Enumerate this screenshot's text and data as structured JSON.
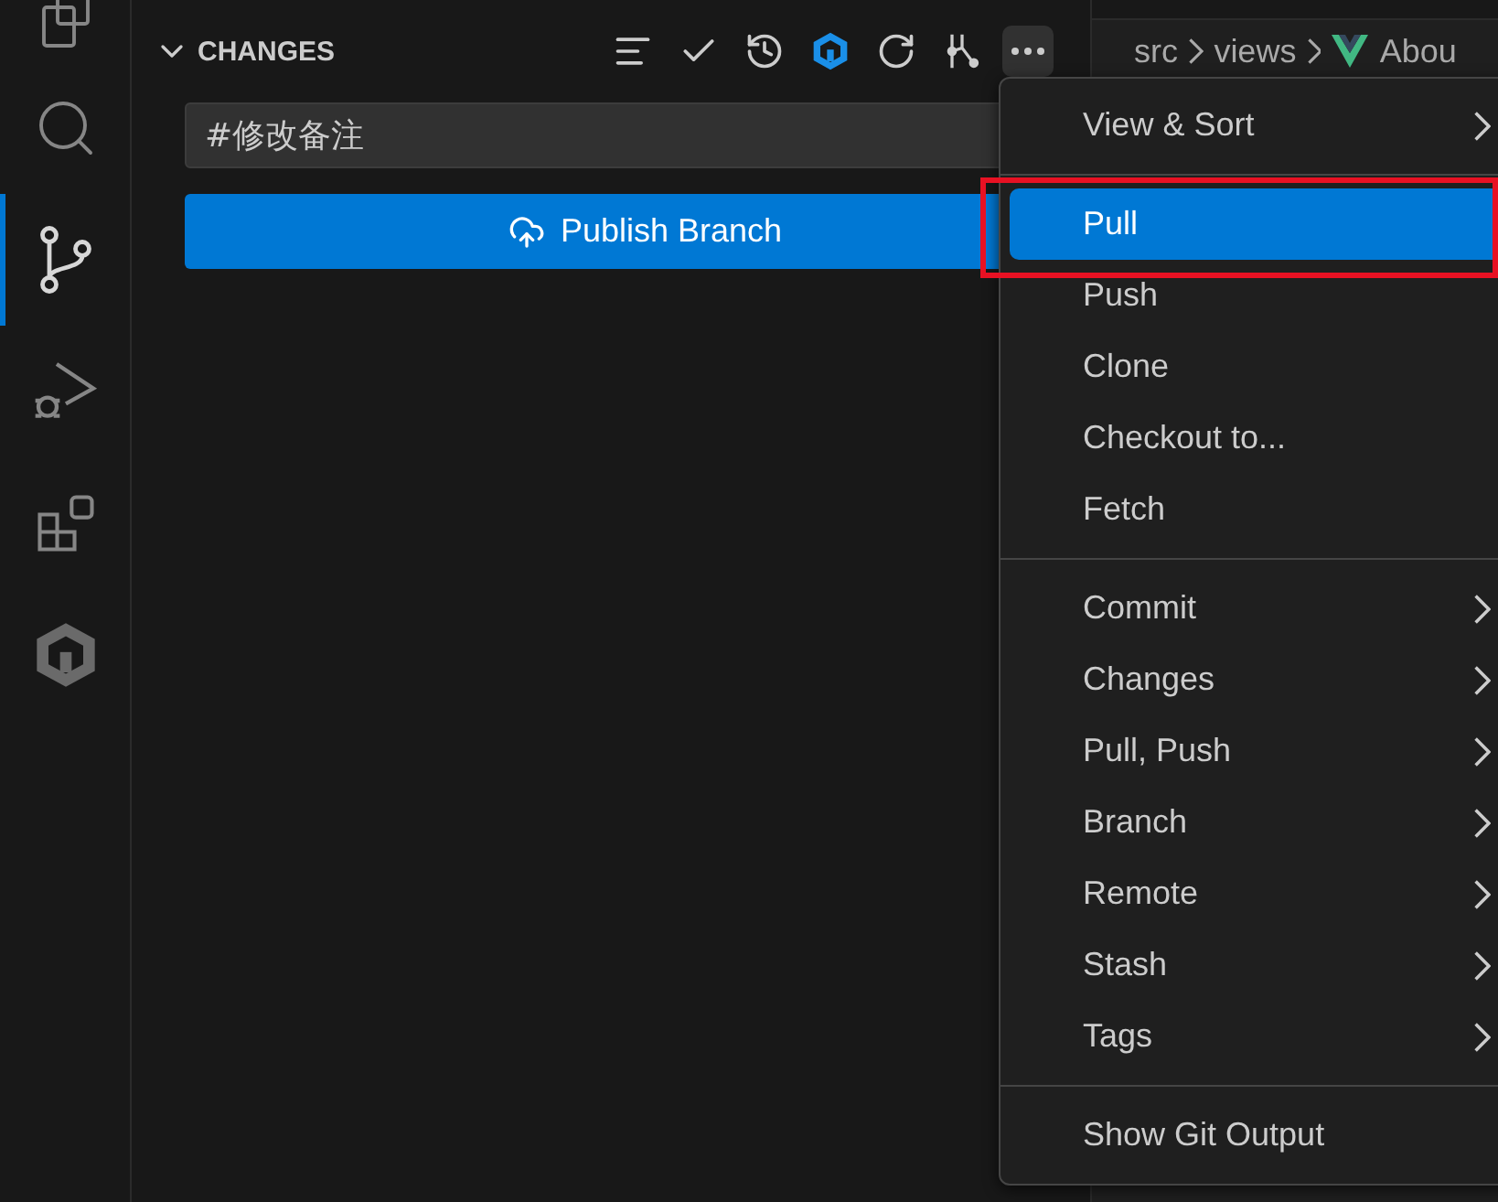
{
  "activity_bar": {
    "items": [
      {
        "kind": "files",
        "selected": false
      },
      {
        "kind": "search",
        "selected": false
      },
      {
        "kind": "source-control",
        "selected": true
      },
      {
        "kind": "debug",
        "selected": false
      },
      {
        "kind": "extensions",
        "selected": false
      },
      {
        "kind": "logo",
        "selected": false
      }
    ]
  },
  "sidebar": {
    "section_title": "CHANGES",
    "expanded": true,
    "toolbar": [
      {
        "kind": "lines"
      },
      {
        "kind": "check"
      },
      {
        "kind": "history"
      },
      {
        "kind": "logo"
      },
      {
        "kind": "refresh"
      },
      {
        "kind": "graph"
      },
      {
        "kind": "more",
        "active": true
      }
    ],
    "message_input": {
      "value": "#修改备注"
    },
    "publish_button": {
      "label": "Publish Branch"
    }
  },
  "breadcrumb": [
    "src",
    "views",
    "Abou"
  ],
  "menu": {
    "groups": [
      [
        {
          "label": "View & Sort",
          "submenu": true,
          "selected": false
        }
      ],
      [
        {
          "label": "Pull",
          "submenu": false,
          "selected": true
        },
        {
          "label": "Push",
          "submenu": false,
          "selected": false
        },
        {
          "label": "Clone",
          "submenu": false,
          "selected": false
        },
        {
          "label": "Checkout to...",
          "submenu": false,
          "selected": false
        },
        {
          "label": "Fetch",
          "submenu": false,
          "selected": false
        }
      ],
      [
        {
          "label": "Commit",
          "submenu": true,
          "selected": false
        },
        {
          "label": "Changes",
          "submenu": true,
          "selected": false
        },
        {
          "label": "Pull, Push",
          "submenu": true,
          "selected": false
        },
        {
          "label": "Branch",
          "submenu": true,
          "selected": false
        },
        {
          "label": "Remote",
          "submenu": true,
          "selected": false
        },
        {
          "label": "Stash",
          "submenu": true,
          "selected": false
        },
        {
          "label": "Tags",
          "submenu": true,
          "selected": false
        }
      ],
      [
        {
          "label": "Show Git Output",
          "submenu": false,
          "selected": false
        }
      ]
    ],
    "annotation_around_selected": true
  }
}
